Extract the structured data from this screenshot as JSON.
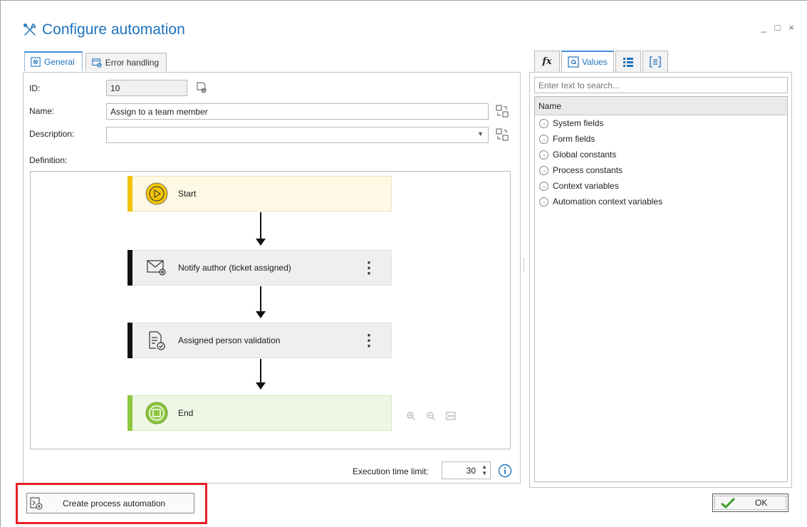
{
  "window": {
    "title": "Configure automation",
    "controls": {
      "minimize": "_",
      "maximize": "□",
      "close": "×"
    }
  },
  "tabs": [
    {
      "label": "General",
      "icon": "gear-icon",
      "active": true
    },
    {
      "label": "Error handling",
      "icon": "error-handling-icon",
      "active": false
    }
  ],
  "form": {
    "id_label": "ID:",
    "id_value": "10",
    "name_label": "Name:",
    "name_value": "Assign to a team member",
    "description_label": "Description:",
    "description_value": "",
    "definition_label": "Definition:"
  },
  "flow": {
    "nodes": [
      {
        "label": "Start",
        "type": "start"
      },
      {
        "label": "Notify author (ticket assigned)",
        "type": "email"
      },
      {
        "label": "Assigned person validation",
        "type": "validation"
      },
      {
        "label": "End",
        "type": "end"
      }
    ],
    "menu_glyph": "⋮"
  },
  "execution": {
    "label": "Execution time limit:",
    "value": "30"
  },
  "right_panel": {
    "tabs": [
      {
        "label": "",
        "icon": "fx-icon",
        "glyph": "fx"
      },
      {
        "label": "Values",
        "icon": "values-icon",
        "active": true
      },
      {
        "label": "",
        "icon": "list-icon"
      },
      {
        "label": "",
        "icon": "bracket-list-icon"
      }
    ],
    "search_placeholder": "Enter text to search...",
    "list_header": "Name",
    "items": [
      "System fields",
      "Form fields",
      "Global constants",
      "Process constants",
      "Context variables",
      "Automation context variables"
    ]
  },
  "buttons": {
    "create": "Create process automation",
    "ok": "OK"
  },
  "colors": {
    "accent": "#1e73be",
    "start_bar": "#f2c100",
    "end_bar": "#8dc63f",
    "highlight": "#e81e24"
  }
}
